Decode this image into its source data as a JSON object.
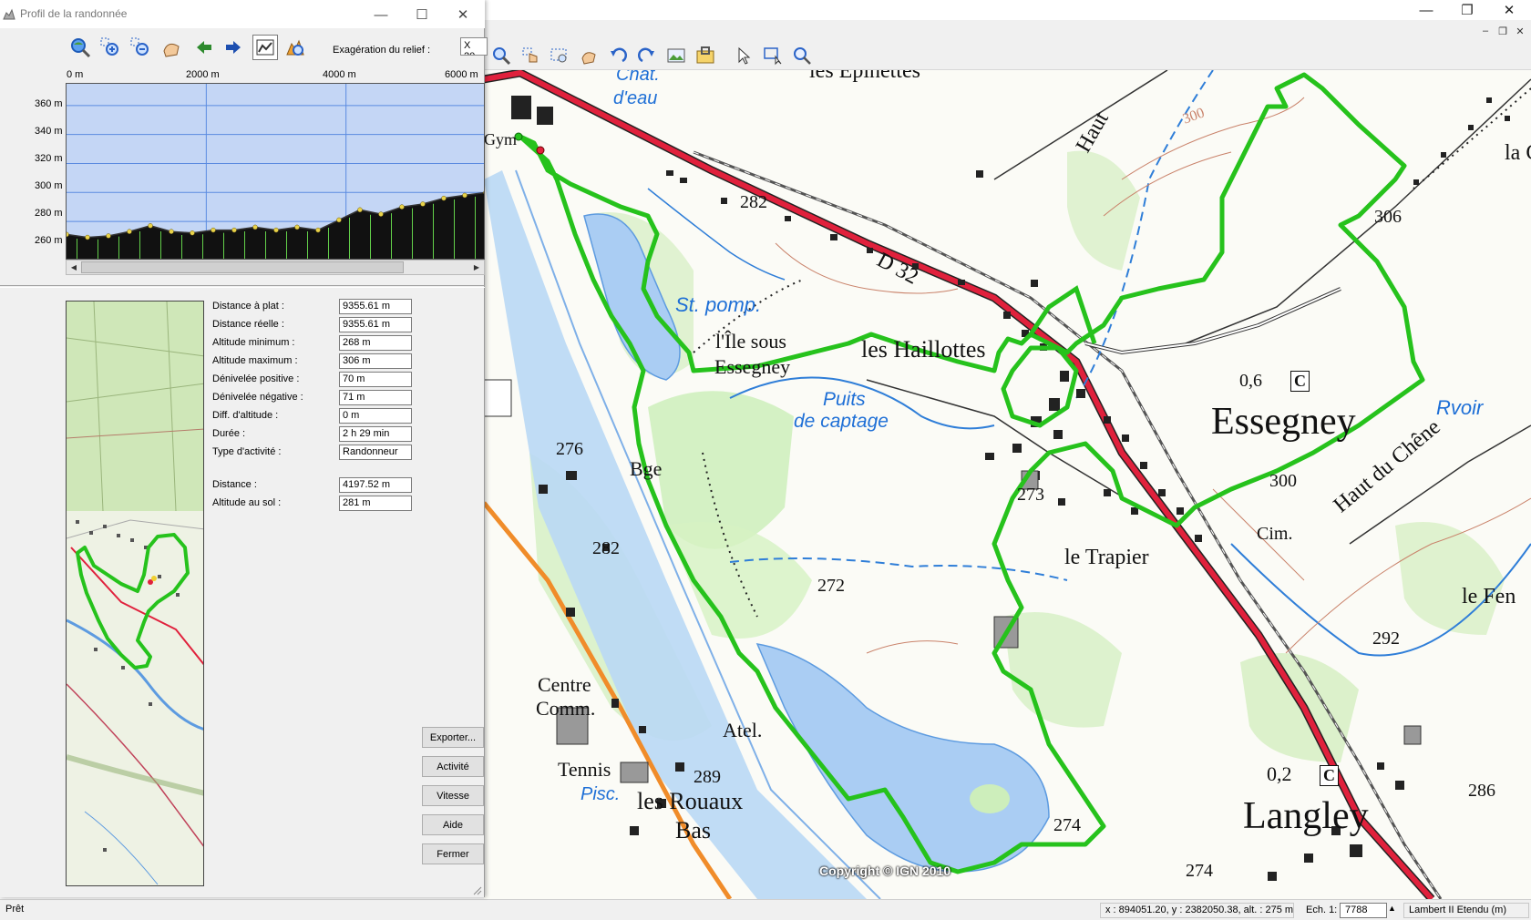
{
  "app": {
    "minimize": "—",
    "restore": "❐",
    "close": "✕",
    "mdi_minimize": "–",
    "mdi_restore": "❐",
    "mdi_close": "✕"
  },
  "dialog": {
    "title": "Profil de la randonnée",
    "minimize": "—",
    "maximize": "☐",
    "close": "✕",
    "exaggeration_label": "Exagération du relief :",
    "exaggeration_value": "X 20"
  },
  "profile": {
    "x_ticks": [
      "0 m",
      "2000 m",
      "4000 m",
      "6000 m"
    ],
    "y_ticks": [
      "360 m",
      "340 m",
      "320 m",
      "300 m",
      "280 m",
      "260 m"
    ],
    "chart_data": {
      "type": "area",
      "x": [
        0,
        300,
        600,
        900,
        1200,
        1500,
        1800,
        2100,
        2400,
        2700,
        3000,
        3300,
        3600,
        3900,
        4200,
        4500,
        4800,
        5100,
        5400,
        5700,
        6000
      ],
      "y": [
        271,
        269,
        270,
        273,
        277,
        273,
        272,
        274,
        274,
        276,
        274,
        276,
        274,
        281,
        288,
        285,
        290,
        292,
        296,
        298,
        300
      ],
      "xlim": [
        0,
        6000
      ],
      "ylim": [
        253,
        375
      ],
      "grid": true,
      "xlabel": "",
      "ylabel": "",
      "colors": {
        "sky": "#c4d6f5",
        "ground": "#111111",
        "grid": "#5b8be0",
        "points": "#e8d24a",
        "stripes": "#63d04a"
      }
    }
  },
  "stats": [
    {
      "label": "Distance à plat :",
      "value": "9355.61 m"
    },
    {
      "label": "Distance réelle :",
      "value": "9355.61 m"
    },
    {
      "label": "Altitude minimum :",
      "value": "268 m"
    },
    {
      "label": "Altitude maximum :",
      "value": "306 m"
    },
    {
      "label": "Dénivelée positive :",
      "value": "70 m"
    },
    {
      "label": "Dénivelée négative :",
      "value": "71 m"
    },
    {
      "label": "Diff. d'altitude :",
      "value": "0 m"
    },
    {
      "label": "Durée :",
      "value": "2 h 29 min"
    },
    {
      "label": "Type d'activité :",
      "value": "Randonneur"
    }
  ],
  "cursor_stats": [
    {
      "label": "Distance :",
      "value": "4197.52 m"
    },
    {
      "label": "Altitude au sol :",
      "value": "281 m"
    }
  ],
  "buttons": {
    "export": "Exporter...",
    "activity": "Activité",
    "speed": "Vitesse",
    "help": "Aide",
    "close": "Fermer"
  },
  "map": {
    "copyright": "Copyright © IGN 2010",
    "labels": {
      "chat_eau": "Chât.",
      "chat_eau2": "d'eau",
      "epinettes": "les Epinettes",
      "gym": "Gym",
      "alt_282a": "282",
      "d32": "D 32",
      "st_pomp": "St. pomp.",
      "ile": "l'Île sous",
      "ile2": "Essegney",
      "haillottes": "les Haillottes",
      "puits": "Puits",
      "puits2": "de captage",
      "haut": "Haut",
      "alt_306": "306",
      "alt_06": "0,6",
      "essegney": "Essegney",
      "rvoir": "Rvoir",
      "alt_300a": "300",
      "alt_300b": "300",
      "chene": "Haut du Chêne",
      "cim": "Cim.",
      "alt_276": "276",
      "bge": "Bge",
      "alt_273": "273",
      "trapier": "le Trapier",
      "alt_282b": "282",
      "alt_272": "272",
      "fen": "le Fen",
      "alt_292": "292",
      "centre": "Centre",
      "comm": "Comm.",
      "atel": "Atel.",
      "tennis": "Tennis",
      "alt_289": "289",
      "pisc": "Pisc.",
      "rouaux": "les Rouaux",
      "bas": "Bas",
      "alt_274a": "274",
      "alt_274b": "274",
      "alt_02": "0,2",
      "langley": "Langley",
      "alt_286": "286",
      "la_c": "la C",
      "c1": "C",
      "c2": "C"
    }
  },
  "status": {
    "ready": "Prêt",
    "coords": "x : 894051.20, y : 2382050.38, alt. : 275 m",
    "scale_label": "Ech. 1:",
    "scale_value": "7788",
    "projection": "Lambert II Etendu (m)"
  }
}
